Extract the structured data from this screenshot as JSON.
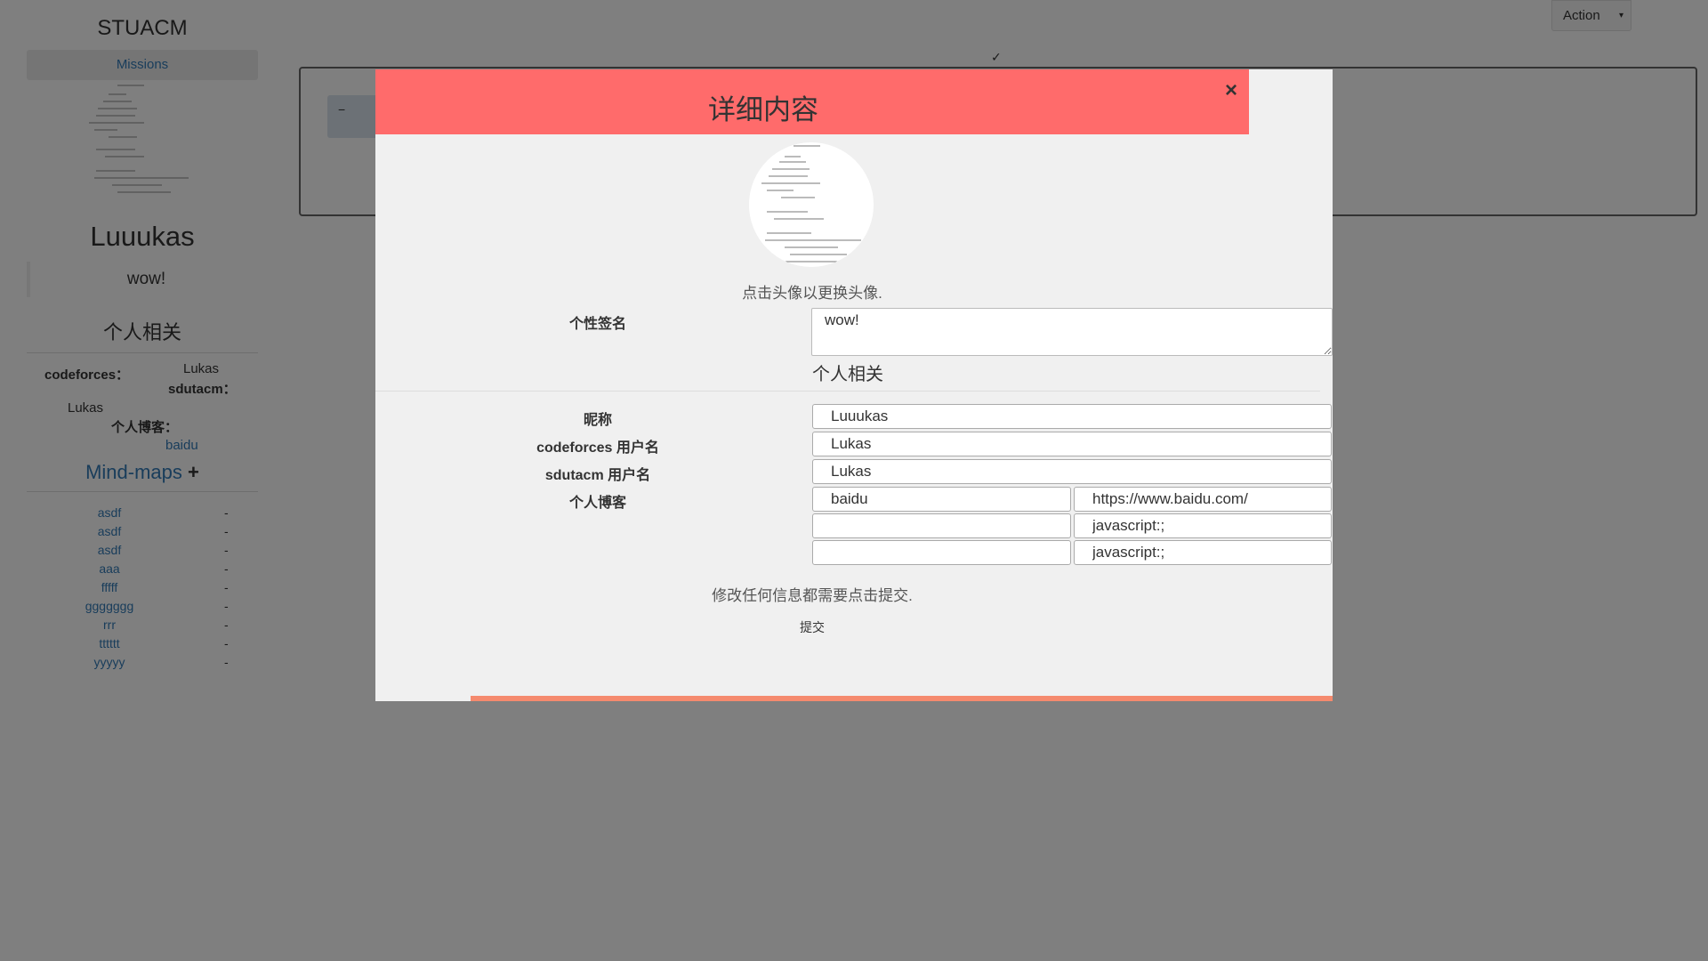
{
  "sidebar": {
    "brand": "STUACM",
    "missions_label": "Missions",
    "nickname": "Luuukas",
    "signature": "wow!",
    "section_title": "个人相关",
    "codeforces_label": "codeforces：",
    "codeforces_value": "Lukas",
    "sdutacm_label": "sdutacm：",
    "sdutacm_value": "Lukas",
    "blog_label": "个人博客：",
    "blog_value": "baidu",
    "mindmaps_title": "Mind-maps",
    "mindmaps_add": "+",
    "mindmaps": [
      {
        "name": "asdf",
        "action": "-"
      },
      {
        "name": "asdf",
        "action": "-"
      },
      {
        "name": "asdf",
        "action": "-"
      },
      {
        "name": "aaa",
        "action": "-"
      },
      {
        "name": "fffff",
        "action": "-"
      },
      {
        "name": "ggggggg",
        "action": "-"
      },
      {
        "name": "rrr",
        "action": "-"
      },
      {
        "name": "tttttt",
        "action": "-"
      },
      {
        "name": "yyyyy",
        "action": "-"
      }
    ]
  },
  "header": {
    "action_label": "Action",
    "action_caret": "▾",
    "check": "✓"
  },
  "main": {
    "tab_label": "−"
  },
  "modal": {
    "title": "详细内容",
    "close": "×",
    "avatar_hint": "点击头像以更换头像.",
    "signature_label": "个性签名",
    "signature_value": "wow!",
    "section_title": "个人相关",
    "nickname_label": "昵称",
    "nickname_value": "Luuukas",
    "codeforces_label": "codeforces 用户名",
    "codeforces_value": "Lukas",
    "sdutacm_label": "sdutacm 用户名",
    "sdutacm_value": "Lukas",
    "blog_label": "个人博客",
    "blogs": [
      {
        "name": "baidu",
        "url": "https://www.baidu.com/"
      },
      {
        "name": "",
        "url": "javascript:;"
      },
      {
        "name": "",
        "url": "javascript:;"
      }
    ],
    "submit_hint": "修改任何信息都需要点击提交.",
    "submit_label": "提交"
  },
  "colors": {
    "modal_header": "#ff6b6b",
    "link": "#337ab7",
    "footer_bar": "#f58a6e"
  }
}
